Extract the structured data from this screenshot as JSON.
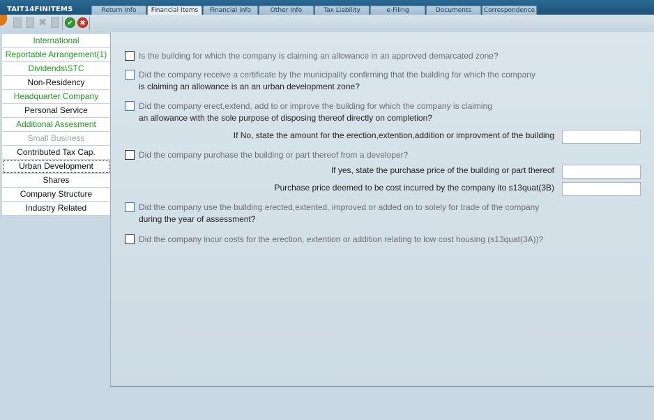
{
  "app": {
    "title": "TAIT14FINITEMS"
  },
  "tabs": [
    {
      "label": "Return Info",
      "active": false
    },
    {
      "label": "Financial Items",
      "active": true
    },
    {
      "label": "Financial info",
      "active": false
    },
    {
      "label": "Other Info",
      "active": false
    },
    {
      "label": "Tax Liability",
      "active": false
    },
    {
      "label": "e-Filing",
      "active": false
    },
    {
      "label": "Documents",
      "active": false
    },
    {
      "label": "Correspondence",
      "active": false
    }
  ],
  "toolbar": {
    "icons": [
      "new-doc-icon",
      "edit-doc-icon",
      "delete-icon",
      "copy-doc-icon",
      "ok-icon",
      "cancel-icon"
    ],
    "ok_glyph": "✔",
    "cancel_glyph": "✖",
    "delete_glyph": "✖"
  },
  "sidebar": {
    "items": [
      {
        "label": "International",
        "color": "#1f9a1f"
      },
      {
        "label": "Reportable Arrangement(1)",
        "color": "#1f9a1f"
      },
      {
        "label": "Dividends\\STC",
        "color": "#1f9a1f"
      },
      {
        "label": "Non-Residency",
        "color": "#111111"
      },
      {
        "label": "Headquarter Company",
        "color": "#1f9a1f"
      },
      {
        "label": "Personal Service",
        "color": "#111111"
      },
      {
        "label": "Additional Assesment",
        "color": "#1f9a1f"
      },
      {
        "label": "Small Business",
        "color": "#a0a6ab"
      },
      {
        "label": "Contributed Tax Cap.",
        "color": "#111111"
      },
      {
        "label": "Urban Development",
        "color": "#111111",
        "selected": true
      },
      {
        "label": "Shares",
        "color": "#111111"
      },
      {
        "label": "Company Structure",
        "color": "#111111"
      },
      {
        "label": "Industry Related",
        "color": "#111111"
      }
    ]
  },
  "form": {
    "q1": {
      "line1": "Is the building for which the company is claiming an allowance in an approved demarcated zone?",
      "line2": ""
    },
    "q2": {
      "line1": "Did the company receive a certificate by the municipality confirming that the building for which the company",
      "line2": "is claiming an allowance is an an urban development zone?"
    },
    "q3": {
      "line1": "Did the company erect,extend, add to or improve the building for which the company is claiming",
      "line2": "an allowance with the sole purpose of disposing thereof directly on completion?"
    },
    "f1": {
      "label": "If No, state the amount for the erection,extention,addition or improvment of the building",
      "value": ""
    },
    "q4": {
      "line1": "Did the company purchase the building or part thereof from a developer?",
      "line2": ""
    },
    "f2": {
      "label": "If yes, state the purchase price of the building or part thereof",
      "value": ""
    },
    "f3": {
      "label": "Purchase price deemed to be cost incurred by the company ito s13quat(3B)",
      "value": ""
    },
    "q5": {
      "line1": "Did the company use the building erected,extented, improved or added on to solely for trade of the company",
      "line2": "during the year of assessment?"
    },
    "q6": {
      "line1": "Did the company incur costs for the erection, extention or addition relating to low cost housing (s13quat(3A))?",
      "line2": ""
    }
  }
}
